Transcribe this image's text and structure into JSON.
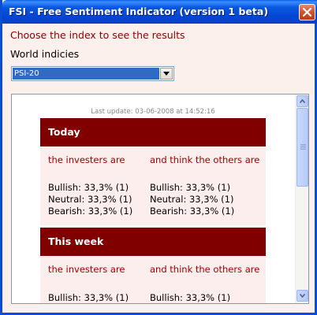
{
  "window": {
    "title": "FSI - Free Sentiment Indicator (version 1 beta)"
  },
  "form": {
    "choose_label": "Choose the index to see the results",
    "group_label": "World indicies",
    "selected_index": "PSI-20"
  },
  "results": {
    "last_update": "Last update: 03-06-2008 at 14:52:16",
    "sections": [
      {
        "heading": "Today",
        "col1_heading": "the investers are",
        "col2_heading": "and think the others are",
        "col1": {
          "bullish": "Bullish: 33,3% (1)",
          "neutral": "Neutral: 33,3% (1)",
          "bearish": "Bearish: 33,3% (1)"
        },
        "col2": {
          "bullish": "Bullish: 33,3% (1)",
          "neutral": "Neutral: 33,3% (1)",
          "bearish": "Bearish: 33,3% (1)"
        }
      },
      {
        "heading": "This week",
        "col1_heading": "the investers are",
        "col2_heading": "and think the others are",
        "col1": {
          "bullish": "Bullish: 33,3% (1)"
        },
        "col2": {
          "bullish": "Bullish: 33,3% (1)"
        }
      }
    ]
  },
  "colors": {
    "titlebar": "#0346d4",
    "section_header": "#800000",
    "section_body": "#fdeeee",
    "accent_text": "#a00000",
    "window_bg": "#fcf0ec",
    "selection": "#316ac5"
  }
}
